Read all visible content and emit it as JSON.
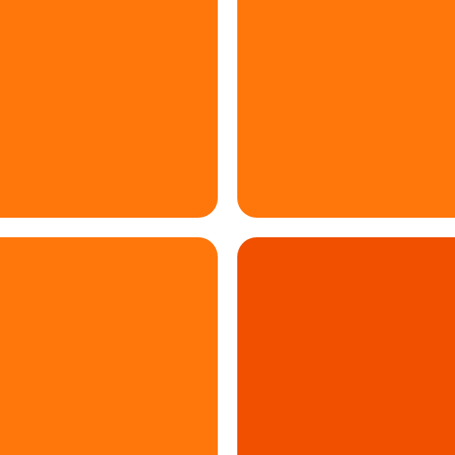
{
  "logo": {
    "icon": "four-square-grid-icon",
    "colors": {
      "background": "#ffffff",
      "primary_orange": "#ff760b",
      "accent_dark_orange": "#f05000"
    },
    "tiles": [
      {
        "name": "top-left",
        "color": "#ff760b"
      },
      {
        "name": "top-right",
        "color": "#ff760b"
      },
      {
        "name": "bottom-left",
        "color": "#ff760b"
      },
      {
        "name": "bottom-right",
        "color": "#f05000"
      }
    ]
  }
}
